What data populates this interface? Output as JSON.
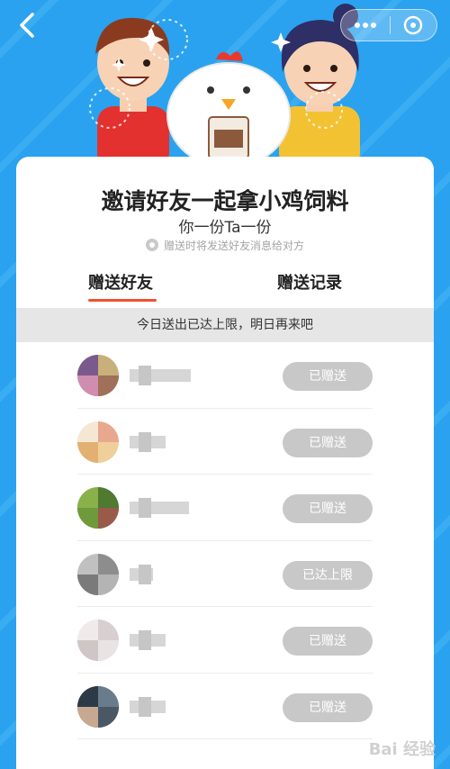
{
  "header": {
    "back_icon": "chevron-left-icon",
    "more_icon": "more-dots-icon",
    "close_icon": "close-target-icon"
  },
  "card": {
    "title": "邀请好友一起拿小鸡饲料",
    "subtitle": "你一份Ta一份",
    "hint": "赠送时将发送好友消息给对方"
  },
  "tabs": [
    {
      "label": "赠送好友",
      "active": true
    },
    {
      "label": "赠送记录",
      "active": false
    }
  ],
  "notice": "今日送出已达上限，明日再来吧",
  "friends": [
    {
      "button": "已赠送"
    },
    {
      "button": "已赠送"
    },
    {
      "button": "已赠送"
    },
    {
      "button": "已达上限"
    },
    {
      "button": "已赠送"
    },
    {
      "button": "已赠送"
    }
  ],
  "watermark": "Bai 经验",
  "colors": {
    "background": "#2aa2ef",
    "accent": "#f0502f",
    "button_disabled": "#c8c8c8"
  }
}
